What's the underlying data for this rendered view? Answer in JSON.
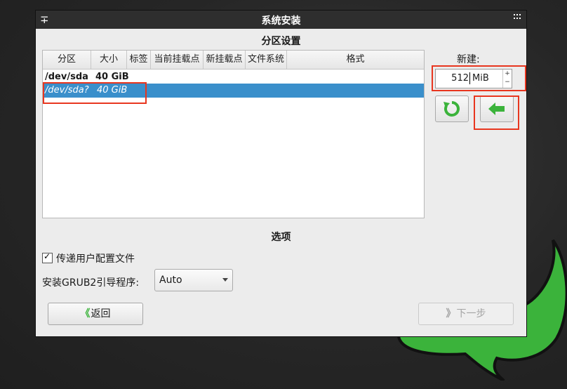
{
  "window": {
    "title": "系统安装"
  },
  "partition_section": {
    "title": "分区设置",
    "columns": [
      "分区",
      "大小",
      "标签",
      "当前挂载点",
      "新挂载点",
      "文件系统",
      "格式"
    ],
    "rows": [
      {
        "partition": "/dev/sda",
        "size": "40 GiB",
        "selected": false
      },
      {
        "partition": "/dev/sda?",
        "size": "40 GiB",
        "selected": true
      }
    ]
  },
  "new_partition": {
    "label": "新建:",
    "size_value": "512",
    "size_unit": "MiB",
    "spin_up": "+",
    "spin_down": "−"
  },
  "options_section": {
    "title": "选项",
    "pass_config_label": "传递用户配置文件",
    "pass_config_checked": true,
    "grub_label": "安装GRUB2引导程序:",
    "grub_value": "Auto"
  },
  "buttons": {
    "back_label": "返回",
    "back_glyph": "《",
    "next_label": "下一步",
    "next_glyph": "》"
  },
  "colors": {
    "selection": "#3a8fcb",
    "highlight_annotation": "#e8361f",
    "accent_green": "#3bb33b"
  },
  "icons": [
    "window-menu-icon",
    "grip-icon",
    "refresh-icon",
    "arrow-left-icon"
  ]
}
